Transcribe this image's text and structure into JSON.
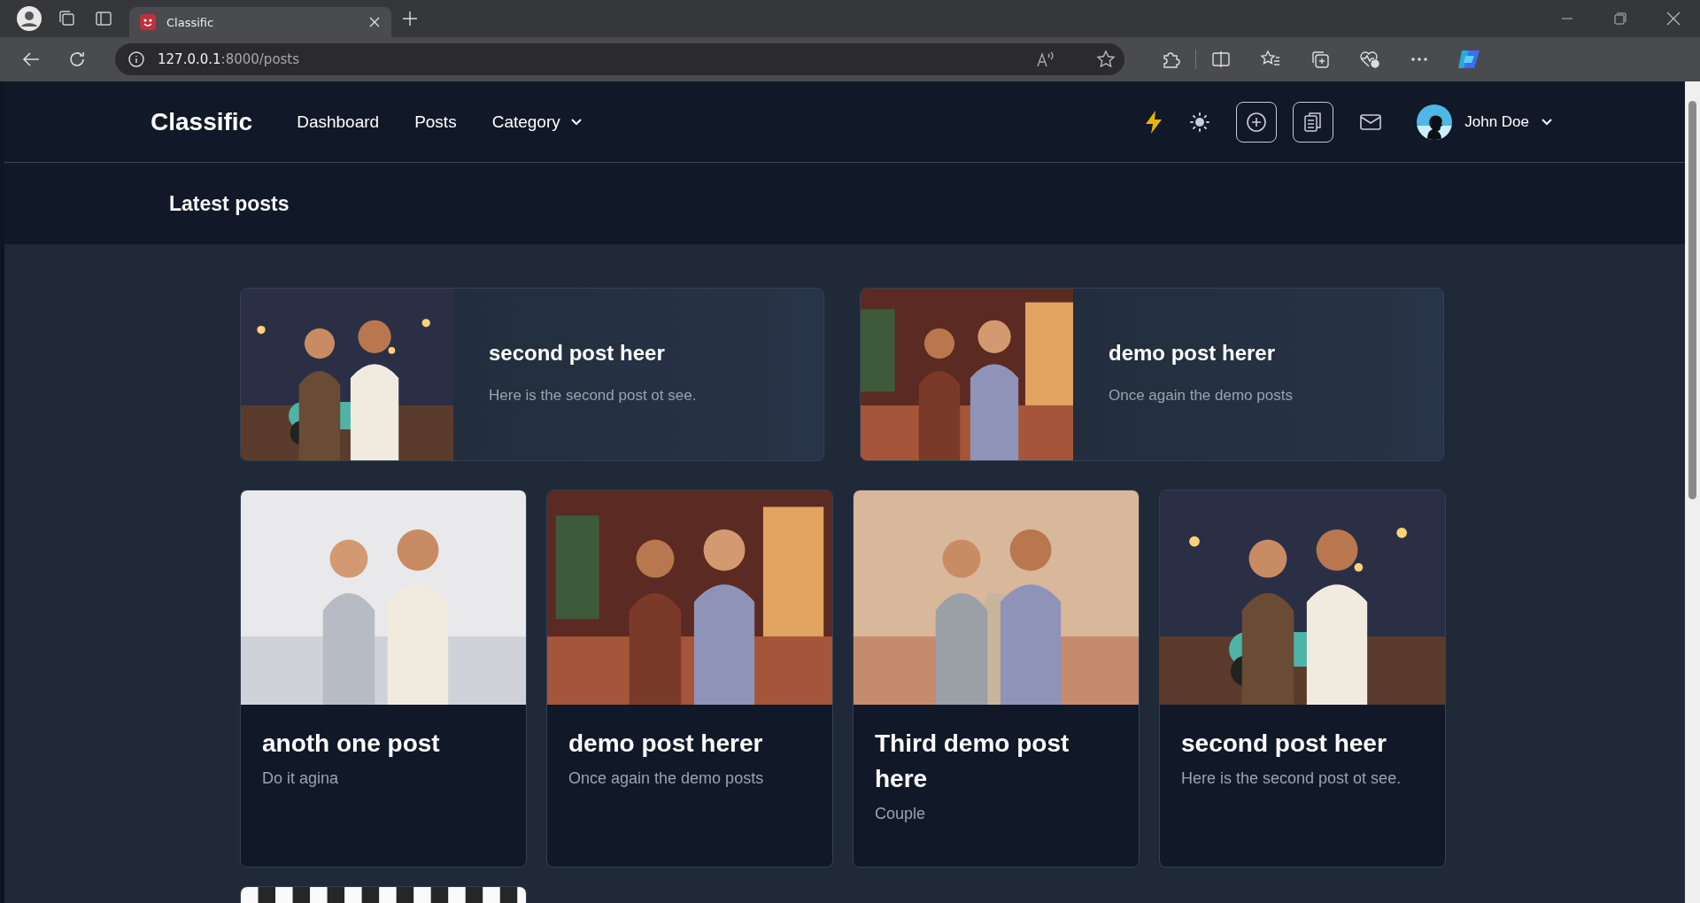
{
  "browser": {
    "tabs": [
      {
        "title": "Classific",
        "selected": true
      }
    ],
    "url_host": "127.0.0.1",
    "url_path": ":8000/posts"
  },
  "navbar": {
    "brand": "Classific",
    "links": [
      {
        "label": "Dashboard",
        "dropdown": false
      },
      {
        "label": "Posts",
        "dropdown": false
      },
      {
        "label": "Category",
        "dropdown": true
      }
    ],
    "user": "John Doe"
  },
  "header": {
    "title": "Latest posts"
  },
  "featured": [
    {
      "title": "second post heer",
      "text": "Here is the second post ot see."
    },
    {
      "title": "demo post herer",
      "text": "Once again the demo posts"
    }
  ],
  "posts": [
    {
      "kind": "post",
      "title": "anoth one post",
      "text": "Do it agina"
    },
    {
      "kind": "post",
      "title": "demo post herer",
      "text": "Once again the demo posts"
    },
    {
      "kind": "post",
      "title": "Third demo post here",
      "text": "Couple"
    },
    {
      "kind": "post",
      "title": "second post heer",
      "text": "Here is the second post ot see."
    },
    {
      "kind": "picture"
    }
  ]
}
